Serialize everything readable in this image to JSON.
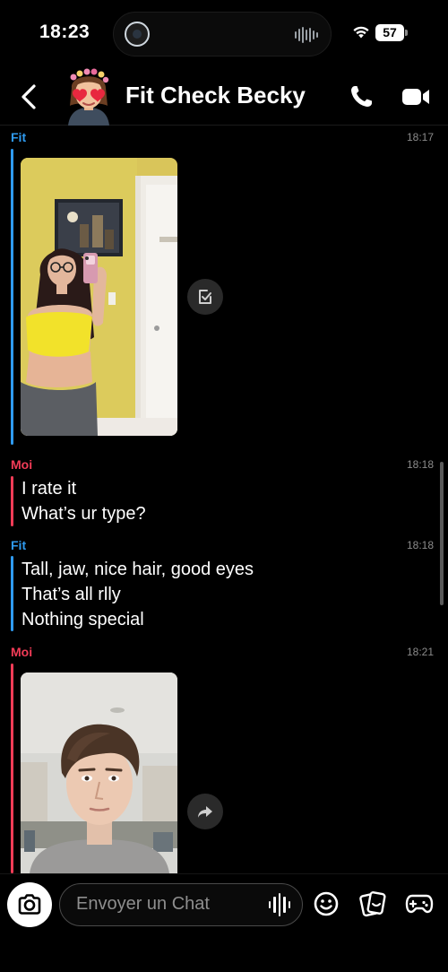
{
  "status_bar": {
    "time": "18:23",
    "battery": "57"
  },
  "header": {
    "title": "Fit Check Becky"
  },
  "messages": [
    {
      "sender": "Fit",
      "time": "18:17"
    },
    {
      "sender": "Moi",
      "time": "18:18",
      "lines": [
        "I rate it",
        "What’s ur type?"
      ]
    },
    {
      "sender": "Fit",
      "time": "18:18",
      "lines": [
        "Tall, jaw, nice hair, good eyes",
        "That’s all rlly",
        "Nothing special"
      ]
    },
    {
      "sender": "Moi",
      "time": "18:21"
    }
  ],
  "composer": {
    "placeholder": "Envoyer un Chat"
  },
  "colors": {
    "fit": "#2f9bf0",
    "moi": "#f23c57",
    "background": "#000000"
  },
  "icons": [
    "back-chevron-icon",
    "phone-icon",
    "video-camera-icon",
    "save-icon",
    "share-arrow-icon",
    "camera-icon",
    "microphone-waveform-icon",
    "smiley-icon",
    "stickers-icon",
    "game-controller-icon"
  ]
}
